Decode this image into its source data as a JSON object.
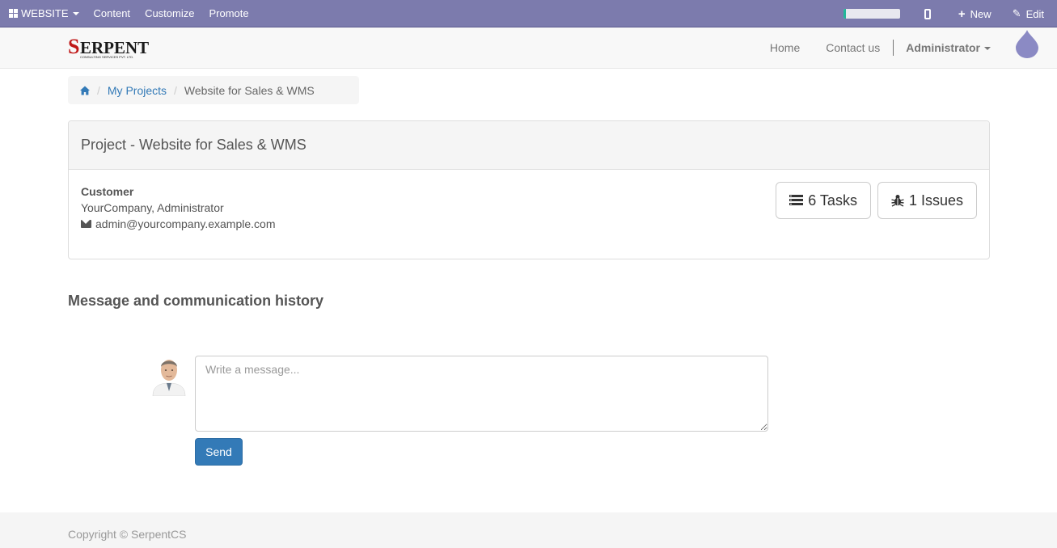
{
  "editor_bar": {
    "website_label": "WEBSITE",
    "menu": [
      "Content",
      "Customize",
      "Promote"
    ],
    "progress": 0.04,
    "progress_color": "#21b799",
    "new_label": "New",
    "edit_label": "Edit",
    "bar_color": "#7c7bad"
  },
  "header": {
    "logo_text": "SERPENT",
    "logo_subtext": "CONSULTING SERVICES PVT. LTD.",
    "nav": {
      "home": "Home",
      "contact": "Contact us",
      "user": "Administrator"
    }
  },
  "breadcrumb": {
    "home_icon": "home-icon",
    "parent": "My Projects",
    "current": "Website for Sales & WMS"
  },
  "project": {
    "title": "Project - Website for Sales & WMS",
    "customer_label": "Customer",
    "customer_name": "YourCompany, Administrator",
    "customer_email": "admin@yourcompany.example.com",
    "tasks_label": "6 Tasks",
    "issues_label": "1 Issues"
  },
  "chatter": {
    "title": "Message and communication history",
    "placeholder": "Write a message...",
    "send_label": "Send"
  },
  "footer": {
    "copyright": "Copyright © SerpentCS"
  },
  "colors": {
    "accent": "#337ab7",
    "drop": "#8b8ac4"
  }
}
